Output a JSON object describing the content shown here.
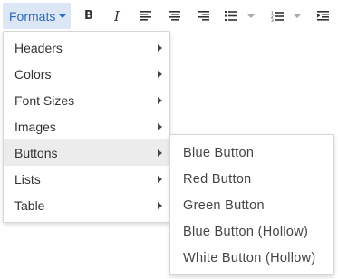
{
  "toolbar": {
    "formats_label": "Formats",
    "bold_glyph": "B",
    "italic_glyph": "I",
    "icons": [
      "align-left-icon",
      "align-center-icon",
      "align-right-icon",
      "bullet-list-icon",
      "numbered-list-icon",
      "indent-icon"
    ]
  },
  "formats_menu": {
    "items": [
      {
        "label": "Headers",
        "has_submenu": true
      },
      {
        "label": "Colors",
        "has_submenu": true
      },
      {
        "label": "Font Sizes",
        "has_submenu": true
      },
      {
        "label": "Images",
        "has_submenu": true
      },
      {
        "label": "Buttons",
        "has_submenu": true,
        "active": true
      },
      {
        "label": "Lists",
        "has_submenu": true
      },
      {
        "label": "Table",
        "has_submenu": true
      }
    ]
  },
  "buttons_submenu": {
    "items": [
      {
        "label": "Blue Button"
      },
      {
        "label": "Red Button"
      },
      {
        "label": "Green Button"
      },
      {
        "label": "Blue Button (Hollow)"
      },
      {
        "label": "White Button (Hollow)"
      }
    ]
  },
  "colors": {
    "accent": "#2a6bc4",
    "formats_bg": "#dde6f4",
    "active_item_bg": "#ececec"
  }
}
